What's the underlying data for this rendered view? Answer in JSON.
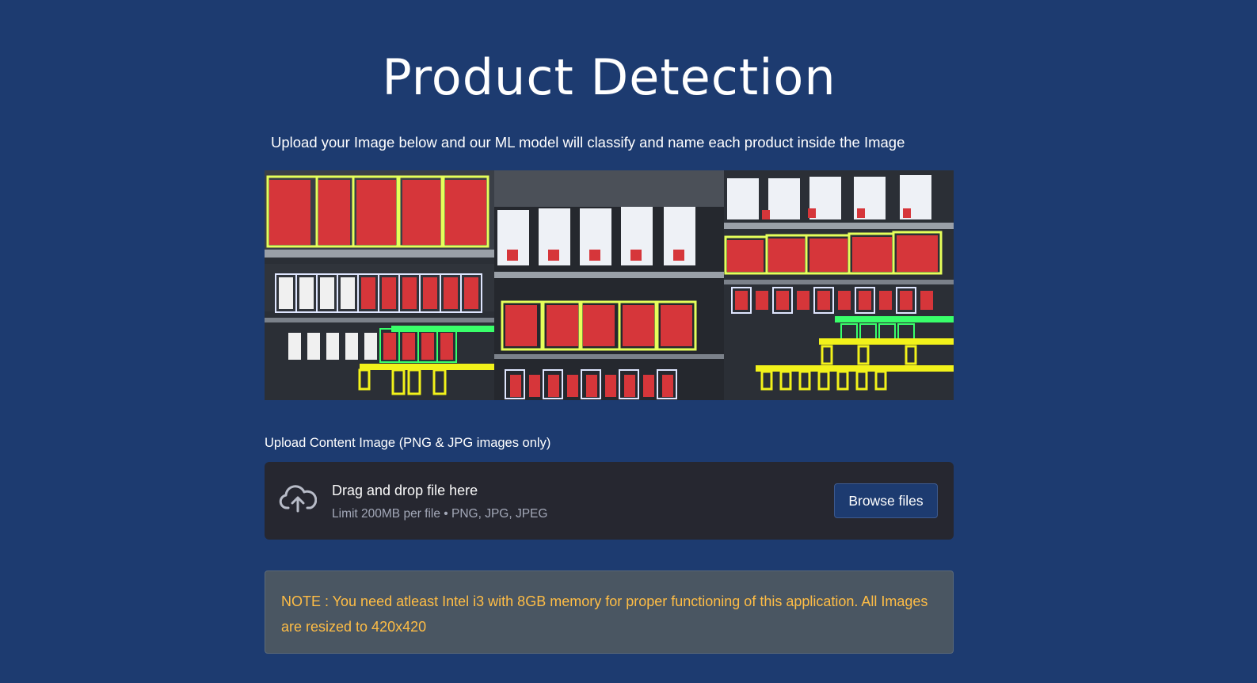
{
  "header": {
    "title": "Product Detection",
    "subtitle": "Upload your Image below and our ML model will classify and name each product inside the Image"
  },
  "gallery": {
    "images": [
      {
        "name": "vending-shelf-detection-1"
      },
      {
        "name": "vending-shelf-detection-2"
      },
      {
        "name": "vending-shelf-detection-3"
      }
    ]
  },
  "uploader": {
    "label": "Upload Content Image (PNG & JPG images only)",
    "drop_text": "Drag and drop file here",
    "limit_text": "Limit 200MB per file • PNG, JPG, JPEG",
    "browse_label": "Browse files",
    "icon": "cloud-upload-icon"
  },
  "note": {
    "text": "NOTE : You need atleast Intel i3 with 8GB memory for proper functioning of this application. All Images are resized to 420x420"
  },
  "colors": {
    "background": "#1d3b70",
    "dropzone_bg": "#262730",
    "note_bg": "#4a5662",
    "note_text": "#ffbd45",
    "detection_yellow": "#e6ff5a",
    "detection_white": "#dfe6ff",
    "detection_green": "#39ff6a",
    "detection_gold": "#f2f21a"
  }
}
